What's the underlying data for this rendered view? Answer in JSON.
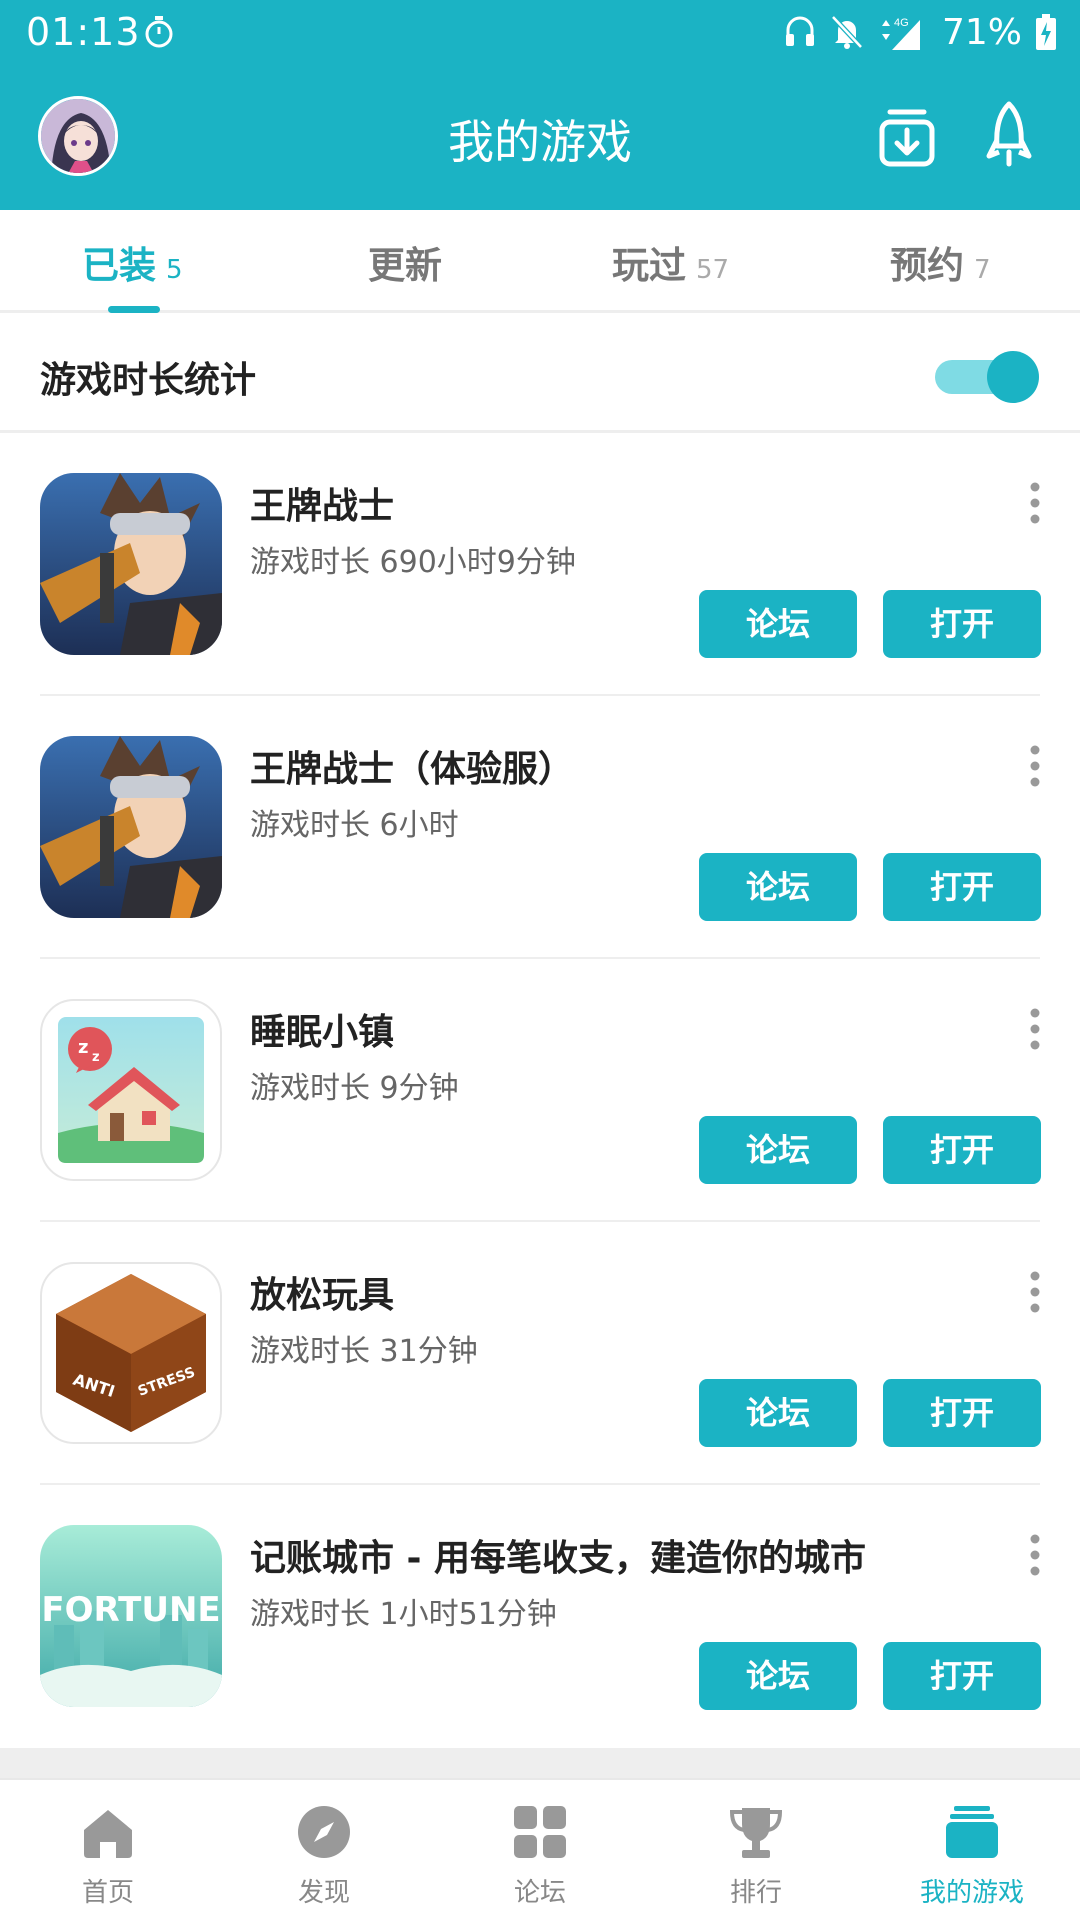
{
  "status_bar": {
    "time": "01:13",
    "network": "4G",
    "battery_percent": "71%"
  },
  "header": {
    "title": "我的游戏",
    "left_icon": "avatar",
    "right_icons": [
      "download-manager-icon",
      "rocket-icon"
    ]
  },
  "tabs": [
    {
      "label": "已装",
      "count": "5",
      "active": true
    },
    {
      "label": "更新",
      "count": "",
      "active": false
    },
    {
      "label": "玩过",
      "count": "57",
      "active": false
    },
    {
      "label": "预约",
      "count": "7",
      "active": false
    }
  ],
  "stats_toggle": {
    "label": "游戏时长统计",
    "on": true
  },
  "games": [
    {
      "name": "王牌战士",
      "playtime": "游戏时长 690小时9分钟",
      "forum_label": "论坛",
      "open_label": "打开",
      "icon": "game-hero-icon"
    },
    {
      "name": "王牌战士（体验服）",
      "playtime": "游戏时长 6小时",
      "forum_label": "论坛",
      "open_label": "打开",
      "icon": "game-hero-icon"
    },
    {
      "name": "睡眠小镇",
      "playtime": "游戏时长 9分钟",
      "forum_label": "论坛",
      "open_label": "打开",
      "icon": "sleep-house-icon"
    },
    {
      "name": "放松玩具",
      "playtime": "游戏时长 31分钟",
      "forum_label": "论坛",
      "open_label": "打开",
      "icon": "anti-stress-cube-icon",
      "icon_text_left": "ANTI",
      "icon_text_right": "STRESS"
    },
    {
      "name": "记账城市 - 用每笔收支，建造你的城市",
      "playtime": "游戏时长 1小时51分钟",
      "forum_label": "论坛",
      "open_label": "打开",
      "icon": "fortune-city-icon",
      "icon_text": "FORTUNE"
    }
  ],
  "bottom_nav": [
    {
      "label": "首页",
      "icon": "home-icon",
      "active": false
    },
    {
      "label": "发现",
      "icon": "compass-icon",
      "active": false
    },
    {
      "label": "论坛",
      "icon": "grid-icon",
      "active": false
    },
    {
      "label": "排行",
      "icon": "trophy-icon",
      "active": false
    },
    {
      "label": "我的游戏",
      "icon": "my-games-icon",
      "active": true
    }
  ],
  "colors": {
    "accent": "#1bb3c4",
    "toggle_track": "#7fdbe4",
    "nav_inactive": "#888888"
  }
}
